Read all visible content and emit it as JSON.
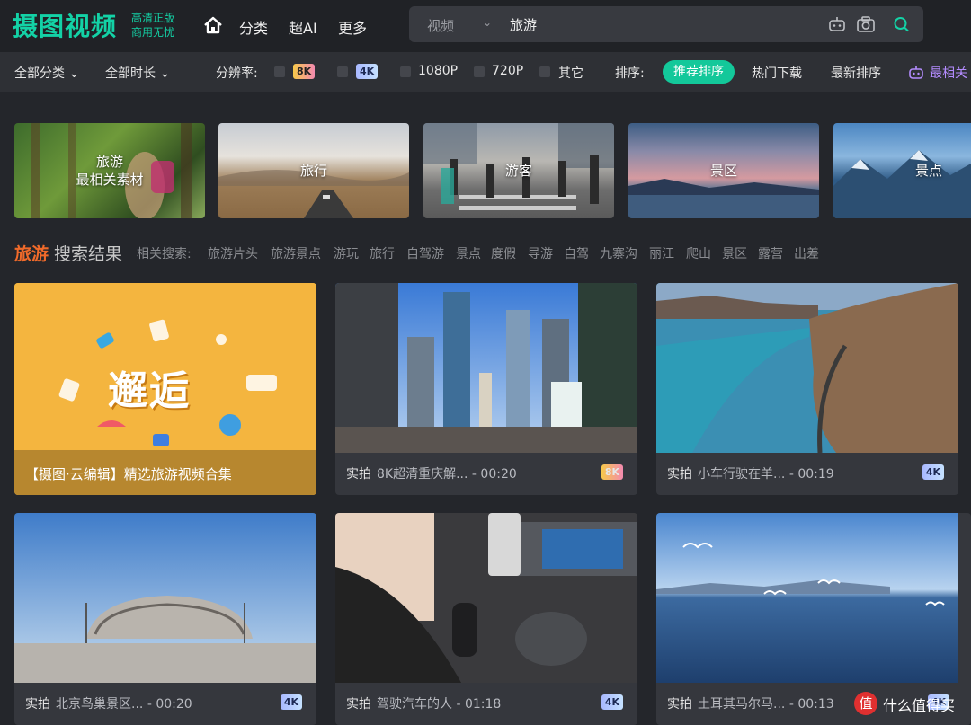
{
  "header": {
    "logo": "摄图视频",
    "tagline_line1": "高清正版",
    "tagline_line2": "商用无忧",
    "nav": [
      "分类",
      "超AI",
      "更多"
    ],
    "search_type": "视频",
    "search_query": "旅游"
  },
  "filters": {
    "all_categories": "全部分类",
    "all_durations": "全部时长",
    "resolution_label": "分辨率:",
    "resolutions": [
      "8K",
      "4K",
      "1080P",
      "720P",
      "其它"
    ],
    "sort_label": "排序:",
    "sort_options": [
      "推荐排序",
      "热门下载",
      "最新排序",
      "最相关"
    ]
  },
  "categories": [
    {
      "line1": "旅游",
      "line2": "最相关素材"
    },
    {
      "line1": "旅行",
      "line2": ""
    },
    {
      "line1": "游客",
      "line2": ""
    },
    {
      "line1": "景区",
      "line2": ""
    },
    {
      "line1": "景点",
      "line2": ""
    }
  ],
  "results": {
    "keyword": "旅游",
    "title": "搜索结果",
    "related_label": "相关搜索:",
    "related_tags": [
      "旅游片头",
      "旅游景点",
      "游玩",
      "旅行",
      "自驾游",
      "景点",
      "度假",
      "导游",
      "自驾",
      "九寨沟",
      "丽江",
      "爬山",
      "景区",
      "露营",
      "出差"
    ]
  },
  "videos": [
    {
      "featured": true,
      "title": "【摄图·云编辑】精选旅游视频合集",
      "cover_text": "邂逅"
    },
    {
      "tag": "实拍",
      "title": "8K超清重庆解...",
      "duration": "- 00:20",
      "badge": "8K"
    },
    {
      "tag": "实拍",
      "title": "小车行驶在羊...",
      "duration": "- 00:19",
      "badge": "4K"
    },
    {
      "tag": "实拍",
      "title": "北京鸟巢景区...",
      "duration": "- 00:20",
      "badge": "4K"
    },
    {
      "tag": "实拍",
      "title": "驾驶汽车的人",
      "duration": "- 01:18",
      "badge": "4K"
    },
    {
      "tag": "实拍",
      "title": "土耳其马尔马...",
      "duration": "- 00:13",
      "badge": "4K"
    }
  ],
  "watermark": {
    "icon_text": "值",
    "text": "什么值得买"
  },
  "colors": {
    "accent": "#13d2a6",
    "keyword": "#f06a2a",
    "background": "#24262b"
  }
}
